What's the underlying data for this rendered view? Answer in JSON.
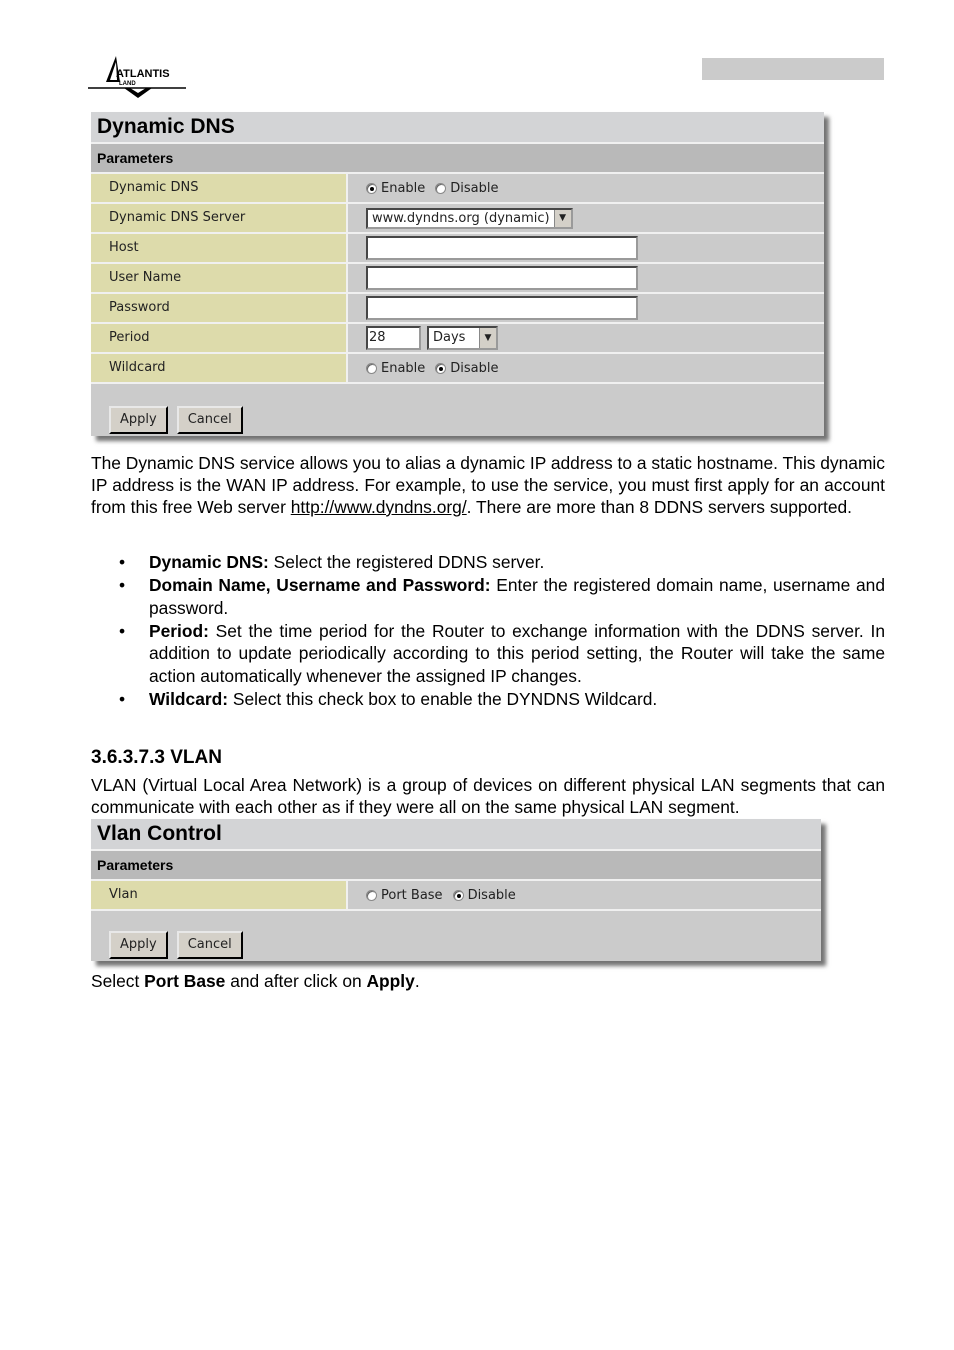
{
  "header": {
    "logo_text": "ATLANTIS",
    "logo_subtext": "LAND"
  },
  "ddns_panel": {
    "title": "Dynamic DNS",
    "section": "Parameters",
    "rows": {
      "dynamic_dns": {
        "label": "Dynamic DNS",
        "options": [
          "Enable",
          "Disable"
        ],
        "selected": "Enable"
      },
      "server": {
        "label": "Dynamic DNS Server",
        "value": "www.dyndns.org (dynamic)"
      },
      "host": {
        "label": "Host",
        "value": ""
      },
      "username": {
        "label": "User Name",
        "value": ""
      },
      "password": {
        "label": "Password",
        "value": ""
      },
      "period": {
        "label": "Period",
        "value": "28",
        "unit": "Days"
      },
      "wildcard": {
        "label": "Wildcard",
        "options": [
          "Enable",
          "Disable"
        ],
        "selected": "Disable"
      }
    },
    "apply_label": "Apply",
    "cancel_label": "Cancel"
  },
  "intro": {
    "text_before_link": "The Dynamic DNS service allows you to alias a dynamic IP address to a static hostname. This dynamic IP address is the WAN IP address. For example, to use the service, you must first apply for an account from this free Web server ",
    "link": "http://www.dyndns.org/",
    "text_after_link": ". There are more than 8 DDNS servers supported."
  },
  "bullets": [
    {
      "term": "Dynamic DNS:",
      "text": " Select the registered DDNS server."
    },
    {
      "term": "Domain Name, Username and Password:",
      "text": " Enter the registered domain name, username and password."
    },
    {
      "term": "Period:",
      "text": " Set the time period for the Router to exchange information with the DDNS server. In addition to update periodically according to this period setting, the Router will take the same action automatically whenever the assigned IP changes."
    },
    {
      "term": "Wildcard:",
      "text": " Select this check box to enable the DYNDNS Wildcard."
    }
  ],
  "bullet_glyph": "•",
  "vlan_section": {
    "heading": "3.6.3.7.3 VLAN",
    "description": "VLAN (Virtual Local Area Network) is a group of devices on different physical LAN segments that can communicate with each other as if they were all on the same physical LAN segment."
  },
  "vlan_panel": {
    "title": "Vlan Control",
    "section": "Parameters",
    "vlan": {
      "label": "Vlan",
      "options": [
        "Port Base",
        "Disable"
      ],
      "selected": "Disable"
    },
    "apply_label": "Apply",
    "cancel_label": "Cancel"
  },
  "footer_note": {
    "pre": "Select ",
    "b1": "Port Base",
    "mid": " and after click on ",
    "b2": "Apply",
    "post": "."
  },
  "icons": {
    "dropdown_arrow": "▼"
  }
}
